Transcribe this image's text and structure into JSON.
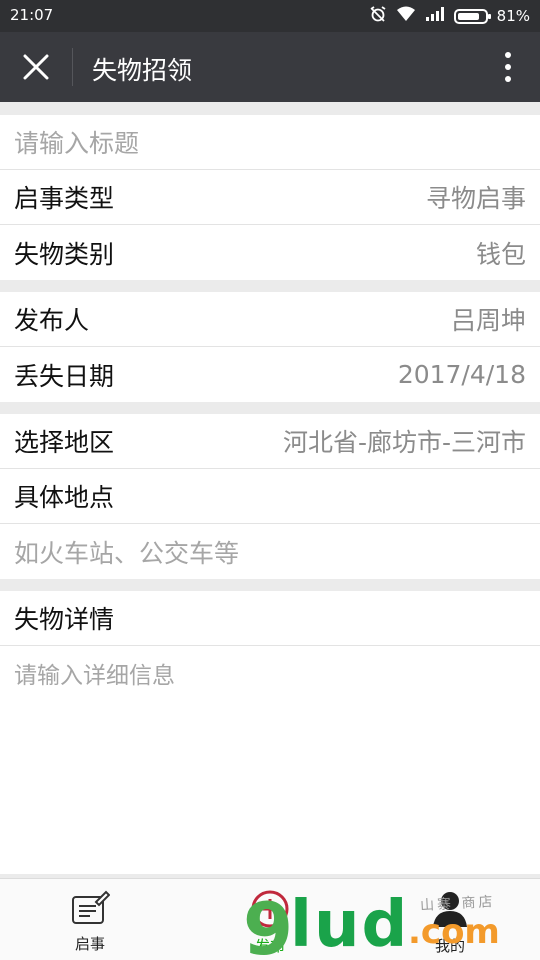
{
  "status_bar": {
    "time": "21:07",
    "battery_text": "81%",
    "battery_level": 0.81
  },
  "header": {
    "title": "失物招领"
  },
  "form": {
    "title_placeholder": "请输入标题",
    "notice_type_label": "启事类型",
    "notice_type_value": "寻物启事",
    "category_label": "失物类别",
    "category_value": "钱包",
    "publisher_label": "发布人",
    "publisher_value": "吕周坤",
    "date_label": "丢失日期",
    "date_value": "2017/4/18",
    "region_label": "选择地区",
    "region_value": "河北省-廊坊市-三河市",
    "location_label": "具体地点",
    "location_placeholder": "如火车站、公交车等",
    "details_label": "失物详情",
    "details_placeholder": "请输入详细信息"
  },
  "tabbar": {
    "tabs": [
      {
        "label": "启事"
      },
      {
        "label": "发布"
      },
      {
        "label": "我的"
      }
    ],
    "active_color": "#1aad19"
  },
  "watermark": {
    "nine": "9",
    "lud": "lud",
    "com": ".com",
    "store": "山寨 商店"
  }
}
